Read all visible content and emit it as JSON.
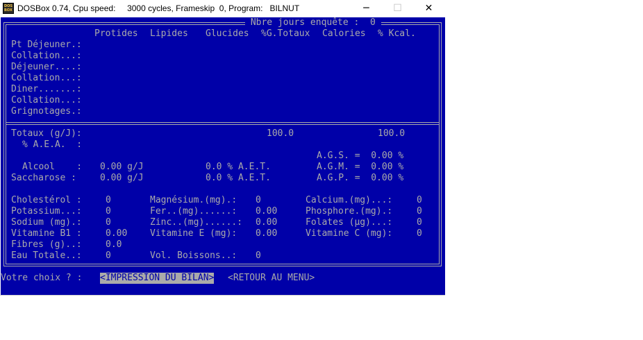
{
  "window": {
    "title": "DOSBox 0.74, Cpu speed:     3000 cycles, Frameskip  0, Program:   BILNUT",
    "icon_label": "DOS BOX",
    "minimize_glyph": "─",
    "maximize_glyph": "☐",
    "close_glyph": "✕"
  },
  "header": {
    "title": " Nbre jours enquête :  0 ",
    "columns": [
      "Protides",
      "Lipides",
      "Glucides",
      "%G.Totaux",
      "Calories",
      "% Kcal."
    ]
  },
  "meals": [
    "Pt Déjeuner.:",
    "Collation...:",
    "Déjeuner....:",
    "Collation...:",
    "Diner.......:",
    "Collation...:",
    "Grignotages.:"
  ],
  "totals": {
    "label": "Totaux (g/J):",
    "gtotaux": "100.0",
    "kcal": "100.0",
    "aea_label": "% A.E.A.  :"
  },
  "fatty_acids": {
    "ags": "A.G.S. =  0.00 %",
    "agm": "A.G.M. =  0.00 %",
    "agp": "A.G.P. =  0.00 %"
  },
  "alcohol": {
    "label": "Alcool    :",
    "value": "0.00 g/J",
    "aet": "0.0 % A.E.T."
  },
  "sucrose": {
    "label": "Saccharose :",
    "value": "0.00 g/J",
    "aet": "0.0 % A.E.T."
  },
  "nutrients": {
    "col1": [
      {
        "label": "Cholestérol :",
        "value": "0"
      },
      {
        "label": "Potassium...:",
        "value": "0"
      },
      {
        "label": "Sodium (mg).:",
        "value": "0"
      },
      {
        "label": "Vitamine B1 :",
        "value": "0.00"
      },
      {
        "label": "Fibres (g)..:",
        "value": "0.0"
      },
      {
        "label": "Eau Totale..:",
        "value": "0"
      }
    ],
    "col2": [
      {
        "label": "Magnésium.(mg).:",
        "value": "0"
      },
      {
        "label": "Fer..(mg)......:",
        "value": "0.00"
      },
      {
        "label": "Zinc..(mg)......:",
        "value": "0.00"
      },
      {
        "label": "Vitamine E (mg):",
        "value": "0.00"
      },
      {
        "label": "Vol. Boissons..:",
        "value": "0"
      }
    ],
    "col3": [
      {
        "label": "Calcium.(mg)...:",
        "value": "0"
      },
      {
        "label": "Phosphore.(mg).:",
        "value": "0"
      },
      {
        "label": "Folates (µg)...:",
        "value": "0"
      },
      {
        "label": "Vitamine C (mg):",
        "value": "0"
      }
    ]
  },
  "footer": {
    "prompt": "Votre choix ? :",
    "print_label": "<IMPRESSION DU BILAN>",
    "menu_label": "<RETOUR AU MENU>"
  },
  "colors": {
    "background": "#0000a8",
    "text": "#aaaaaa"
  }
}
